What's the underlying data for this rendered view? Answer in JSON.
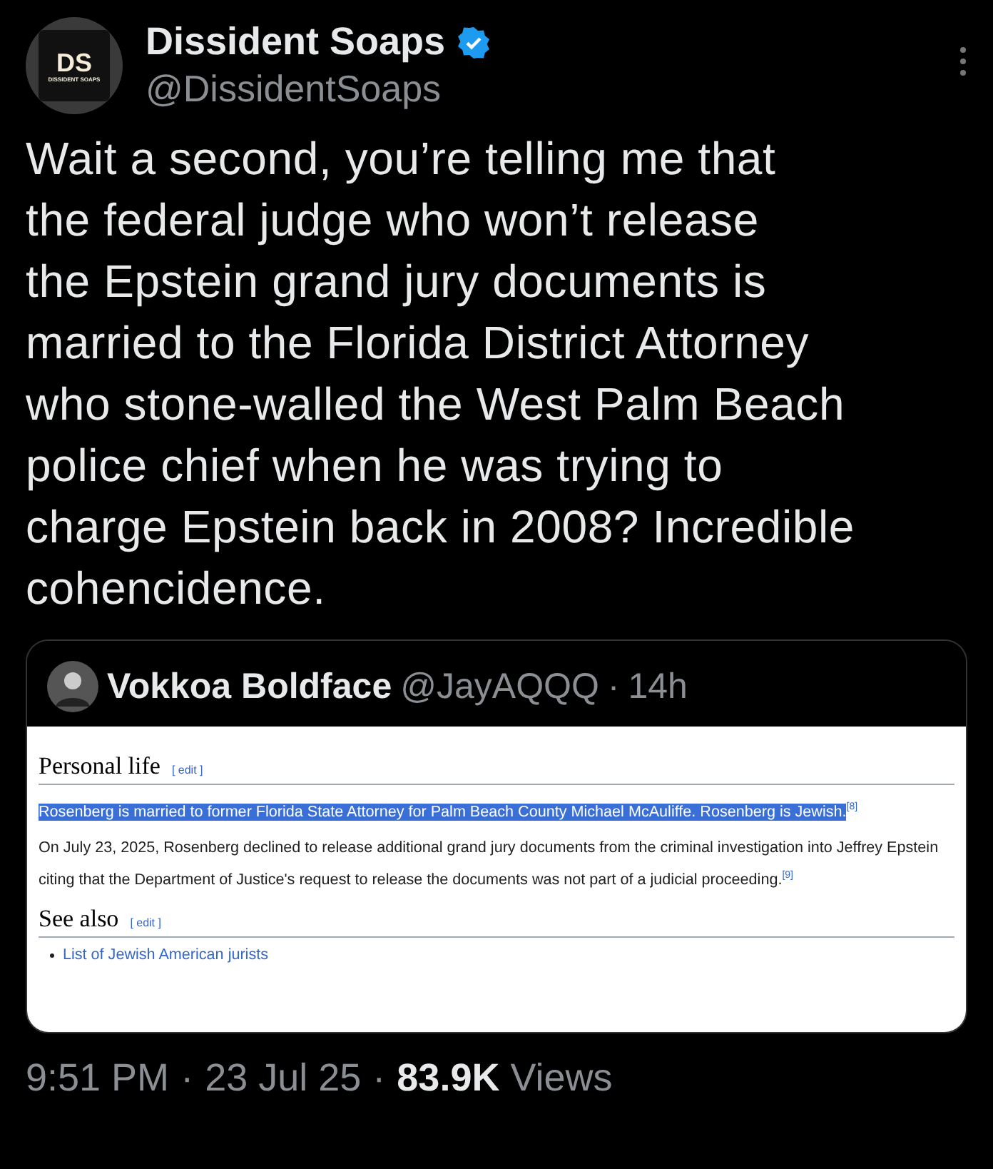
{
  "author": {
    "name": "Dissident Soaps",
    "handle": "@DissidentSoaps",
    "verified": true,
    "avatar": {
      "initials": "DS",
      "caption": "DISSIDENT SOAPS"
    }
  },
  "text_lines": [
    "Wait a second, you’re telling me that",
    "the federal judge who won’t release",
    "the Epstein grand jury documents is",
    "married to the Florida District Attorney",
    "who stone-walled the West Palm Beach",
    "police chief when he was trying to",
    "charge Epstein back in 2008? Incredible",
    "cohencidence."
  ],
  "quote": {
    "name": "Vokkoa Boldface",
    "handle": "@JayAQQQ",
    "separator": "·",
    "time": "14h",
    "page": {
      "sections": [
        {
          "heading": "Personal life",
          "edit": "[ edit ]",
          "paragraphs": [
            {
              "text": "Rosenberg is married to former Florida State Attorney for Palm Beach County Michael McAuliffe. Rosenberg is Jewish.",
              "ref": "[8]",
              "selected": true
            },
            {
              "text": "On July 23, 2025, Rosenberg declined to release additional grand jury documents from the criminal investigation into Jeffrey Epstein citing that the Department of Justice's request to release the documents was not part of a judicial proceeding.",
              "ref": "[9]",
              "selected": false
            }
          ]
        },
        {
          "heading": "See also",
          "edit": "[ edit ]",
          "links": [
            "List of Jewish American jurists"
          ]
        }
      ]
    }
  },
  "footer": {
    "time": "9:51 PM",
    "separator_1": "·",
    "date": "23 Jul 25",
    "separator_2": "·",
    "views_count": "83.9K",
    "views_label": "Views"
  }
}
